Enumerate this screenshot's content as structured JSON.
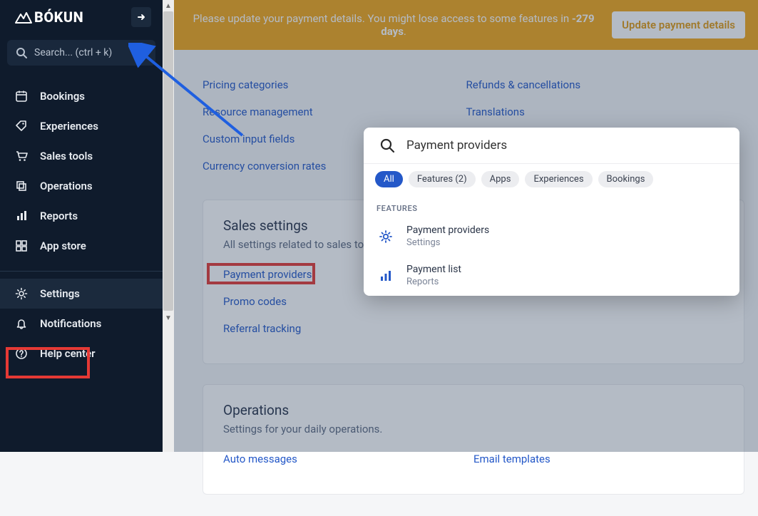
{
  "brand": "BÓKUN",
  "search_placeholder": "Search... (ctrl + k)",
  "sidebar": {
    "items": [
      {
        "label": "Bookings"
      },
      {
        "label": "Experiences"
      },
      {
        "label": "Sales tools"
      },
      {
        "label": "Operations"
      },
      {
        "label": "Reports"
      },
      {
        "label": "App store"
      }
    ],
    "lower": [
      {
        "label": "Settings"
      },
      {
        "label": "Notifications"
      },
      {
        "label": "Help center"
      }
    ]
  },
  "banner": {
    "prefix": "Please update your payment details. You might lose access to some features in ",
    "days": "-279 days",
    "suffix": ".",
    "cta": "Update payment details"
  },
  "top_links": {
    "left": [
      "Pricing categories",
      "Resource management",
      "Custom input fields",
      "Currency conversion rates"
    ],
    "right": [
      "Refunds & cancellations",
      "Translations"
    ]
  },
  "sales_section": {
    "title": "Sales settings",
    "subtitle": "All settings related to sales tools.",
    "links": [
      "Payment providers",
      "Promo codes",
      "Referral tracking"
    ]
  },
  "ops_section": {
    "title": "Operations",
    "subtitle": "Settings for your daily operations.",
    "links": [
      "Auto messages",
      "Email templates"
    ]
  },
  "popup": {
    "query": "Payment providers",
    "chips": [
      "All",
      "Features (2)",
      "Apps",
      "Experiences",
      "Bookings"
    ],
    "group": "FEATURES",
    "results": [
      {
        "title": "Payment providers",
        "sub": "Settings"
      },
      {
        "title": "Payment list",
        "sub": "Reports"
      }
    ]
  }
}
